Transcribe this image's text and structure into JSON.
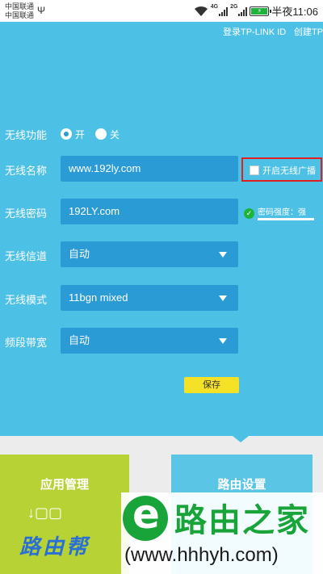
{
  "status_bar": {
    "carrier_1": "中国联通",
    "carrier_2": "中国联通",
    "net_1": "4G",
    "net_2": "2G",
    "time": "半夜11:06",
    "battery_color": "#1eb43c"
  },
  "header": {
    "login_link": "登录TP-LINK ID",
    "create_link": "创建TP"
  },
  "form": {
    "wireless_function": {
      "label": "无线功能",
      "options": [
        "开",
        "关"
      ],
      "selected": "开"
    },
    "ssid": {
      "label": "无线名称",
      "value": "www.192ly.com",
      "broadcast_label": "开启无线广播",
      "broadcast_checked": false
    },
    "password": {
      "label": "无线密码",
      "value": "192LY.com",
      "strength_text": "密码强度：强"
    },
    "channel": {
      "label": "无线信道",
      "value": "自动"
    },
    "mode": {
      "label": "无线模式",
      "value": "11bgn mixed"
    },
    "bandwidth": {
      "label": "频段带宽",
      "value": "自动"
    },
    "save_label": "保存"
  },
  "tiles": {
    "app_manage": "应用管理",
    "router_settings": "路由设置"
  },
  "watermark": {
    "name": "路由之家",
    "url": "(www.hhhyh.com)",
    "left_text": "路由帮"
  },
  "colors": {
    "panel_blue": "#4dc0e6",
    "field_blue": "#2a9bd5",
    "save_yellow": "#f5e126",
    "tile_green": "#b7d234",
    "highlight_red": "#e02020",
    "watermark_green": "#19a43a"
  }
}
